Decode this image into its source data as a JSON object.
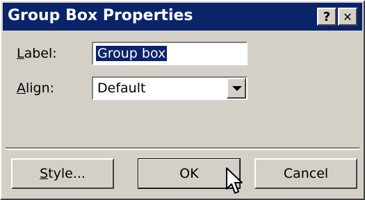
{
  "window": {
    "title": "Group Box Properties",
    "help_glyph": "?",
    "close_glyph": "✕"
  },
  "form": {
    "label_field": {
      "label_prefix": "",
      "label_hotkey": "L",
      "label_rest": "abel:",
      "value": "Group box"
    },
    "align_field": {
      "label_hotkey": "A",
      "label_rest": "lign:",
      "value": "Default"
    }
  },
  "buttons": {
    "style": {
      "hotkey": "S",
      "rest": "tyle..."
    },
    "ok": "OK",
    "cancel": "Cancel"
  },
  "colors": {
    "titlebar": "#0a246a",
    "face": "#d4d0c8",
    "selection": "#0a246a"
  }
}
